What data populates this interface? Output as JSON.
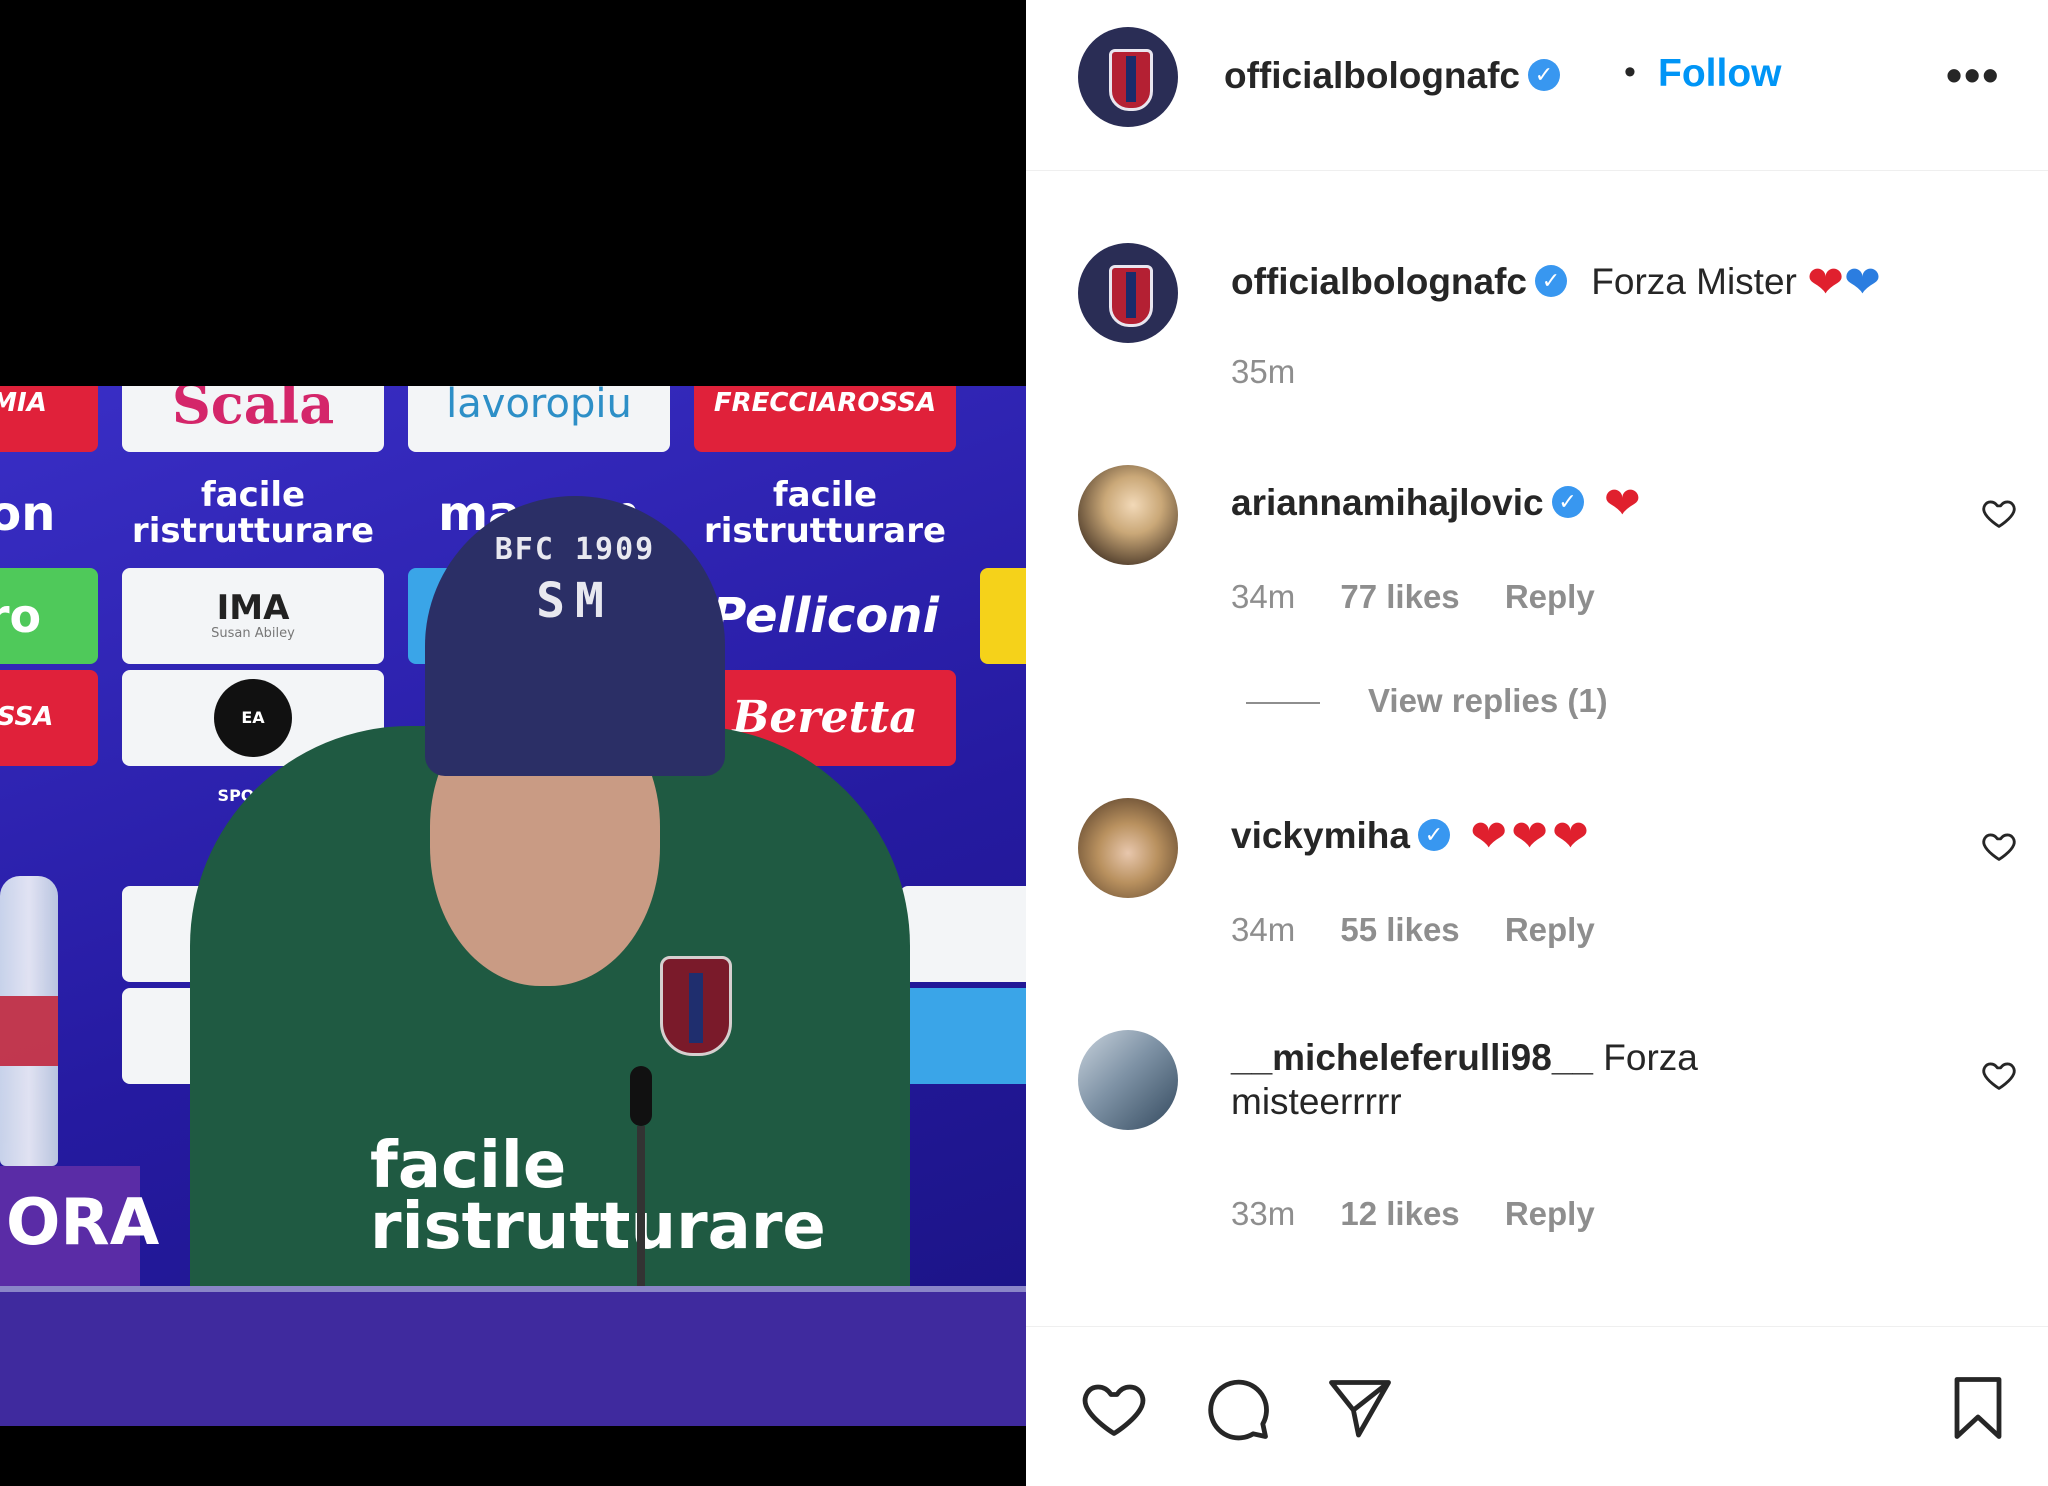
{
  "post": {
    "author": "officialbolognafc",
    "follow_label": "Follow",
    "separator": "•",
    "more_label": "•••"
  },
  "media": {
    "sponsors": {
      "scala": "Scala",
      "lavoropiu": "lavoropiu",
      "frecciarossa": "FRECCIAROSSA",
      "facile_1": "facile ristrutturare",
      "facile_2": "facile ristrutturare",
      "macron": "macron",
      "ima": "IMA",
      "ima_sub": "Susan Abiley",
      "pelliconi": "Pelliconi",
      "beretta": "Beretta",
      "ea": "EA SPORTS",
      "ro": "ro",
      "ossa": "OSSA",
      "ron": "ron",
      "mia": "MIA"
    },
    "beanie_top": "BFC 1909",
    "beanie_initials": "SM",
    "jacket_text": "facile ristrutturare",
    "desk_text": "ORA"
  },
  "caption": {
    "username": "officialbolognafc",
    "text": "Forza Mister",
    "time": "35m"
  },
  "comments": [
    {
      "username": "ariannamihajlovic",
      "text": "",
      "time": "34m",
      "likes": "77 likes",
      "reply": "Reply"
    },
    {
      "username": "vickymiha",
      "text": "",
      "time": "34m",
      "likes": "55 likes",
      "reply": "Reply"
    },
    {
      "username": "__micheleferulli98__",
      "text": "Forza misteerrrrr",
      "time": "33m",
      "likes": "12 likes",
      "reply": "Reply"
    }
  ],
  "view_replies": "View replies (1)",
  "colors": {
    "accent": "#0095f6",
    "verified": "#3897f0",
    "muted": "#8e8e8e",
    "heart_red": "#e0202e",
    "heart_blue": "#2b7de0"
  },
  "icons": {
    "like": "heart-outline-icon",
    "comment": "comment-bubble-icon",
    "share": "paper-plane-icon",
    "save": "bookmark-icon",
    "verified": "verified-badge-icon",
    "more": "more-options-icon"
  }
}
